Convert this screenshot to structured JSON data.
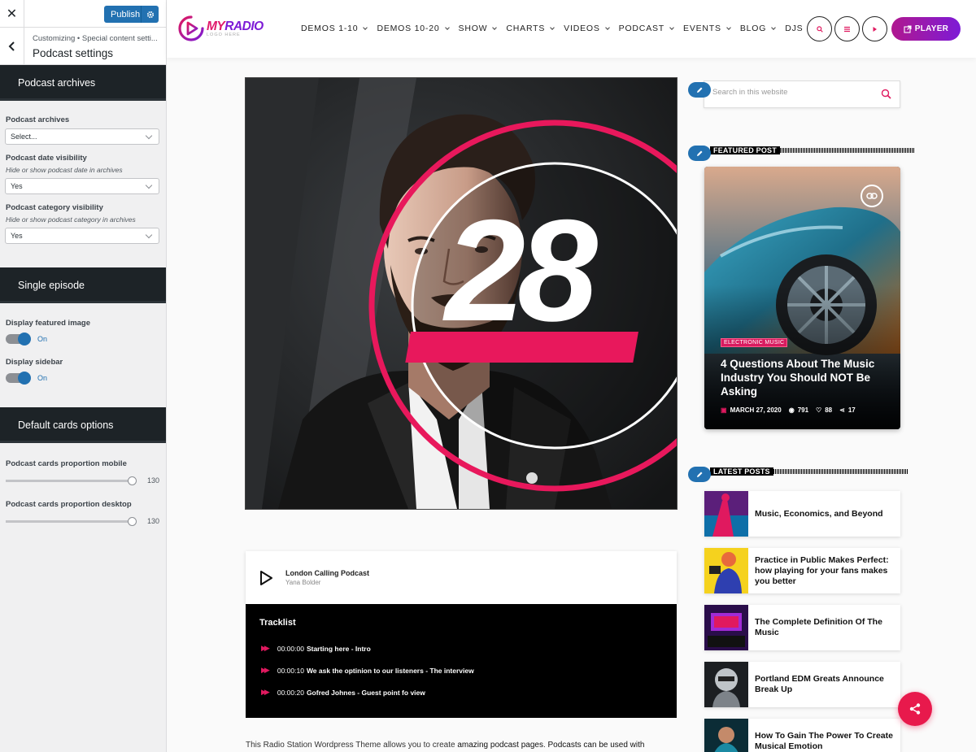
{
  "customizer": {
    "close_symbol": "✕",
    "publish_label": "Publish",
    "breadcrumb": "Customizing • Special content setti...",
    "title": "Podcast settings",
    "sections": {
      "archives": {
        "heading": "Podcast archives",
        "archives_label": "Podcast archives",
        "archives_value": "Select...",
        "date_label": "Podcast date visibility",
        "date_desc": "Hide or show podcast date in archives",
        "date_value": "Yes",
        "category_label": "Podcast category visibility",
        "category_desc": "Hide or show podcast category in archives",
        "category_value": "Yes"
      },
      "single": {
        "heading": "Single episode",
        "featured_label": "Display featured image",
        "featured_state": "On",
        "sidebar_label": "Display sidebar",
        "sidebar_state": "On"
      },
      "cards": {
        "heading": "Default cards options",
        "mobile_label": "Podcast cards proportion mobile",
        "mobile_value": "130",
        "desktop_label": "Podcast cards proportion desktop",
        "desktop_value": "130"
      }
    },
    "accent_color": "#2271b1"
  },
  "site": {
    "logo": {
      "name_left": "MY",
      "name_right": "RADIO",
      "tagline": "LOGO HERE"
    },
    "nav": [
      "DEMOS 1-10",
      "DEMOS 10-20",
      "SHOW",
      "CHARTS",
      "VIDEOS",
      "PODCAST",
      "EVENTS",
      "BLOG",
      "DJS"
    ],
    "player_label": "PLAYER",
    "hero_number": "28",
    "podcast": {
      "title": "London Calling Podcast",
      "author": "Yana Bolder"
    },
    "tracklist": {
      "title": "Tracklist",
      "tracks": [
        {
          "time": "00:00:00",
          "name": "Starting here - Intro"
        },
        {
          "time": "00:00:10",
          "name": "We ask the optinion to our listeners - The interview"
        },
        {
          "time": "00:00:20",
          "name": "Gofred Johnes - Guest point fo view"
        }
      ]
    },
    "intro": {
      "part1": "This Radio Station Wordpress Theme allows you to create ",
      "bold1": "amazing podcast pages",
      "part2": ". ",
      "bold2": "Podcasts can be used with"
    },
    "search_placeholder": "Search in this website",
    "featured_title": "FEATURED POST",
    "featured": {
      "tag": "ELECTRONIC MUSIC",
      "title": "4 Questions About The Music Industry You Should NOT Be Asking",
      "date": "MARCH 27, 2020",
      "views": "791",
      "likes": "88",
      "shares": "17"
    },
    "latest_title": "LATEST POSTS",
    "latest": [
      "Music, Economics, and Beyond",
      "Practice in Public Makes Perfect: how playing for your fans makes you better",
      "The Complete Definition Of The Music",
      "Portland EDM Greats Announce Break Up",
      "How To Gain The Power To Create Musical Emotion"
    ],
    "brand_pink": "#e0195f",
    "brand_purple": "#7d1bd6"
  }
}
